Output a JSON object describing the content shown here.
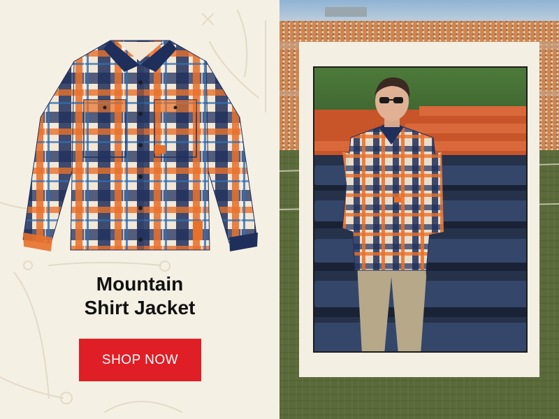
{
  "product": {
    "title_line1": "Mountain",
    "title_line2": "Shirt Jacket"
  },
  "cta": {
    "label": "SHOP NOW"
  },
  "colors": {
    "background": "#f5f0e4",
    "accent": "#e01e26",
    "plaid_navy": "#1f2f5c",
    "plaid_orange": "#e8702a",
    "plaid_cream": "#f3e7d6",
    "seat_navy": "#2b3a55"
  },
  "icons": {
    "shirt": "plaid-shirt-jacket-image",
    "photo": "stadium-model-photo"
  }
}
